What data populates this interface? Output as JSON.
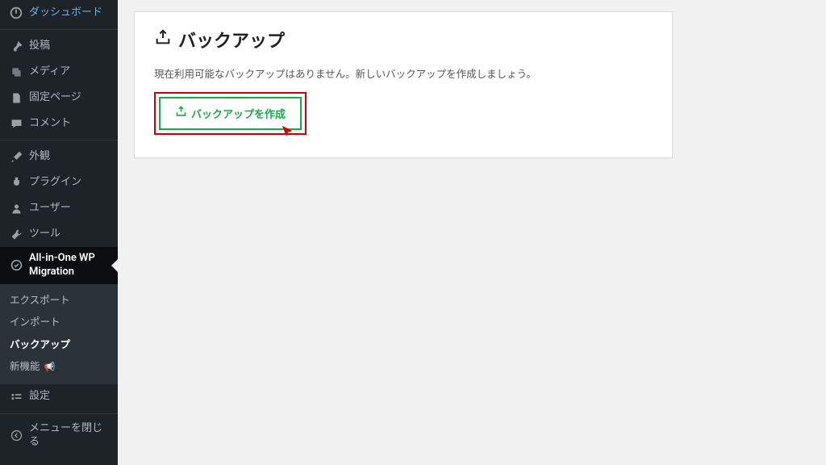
{
  "sidebar": {
    "items": [
      {
        "icon": "dashboard-icon",
        "label": "ダッシュボード"
      },
      {
        "icon": "pin-icon",
        "label": "投稿"
      },
      {
        "icon": "media-icon",
        "label": "メディア"
      },
      {
        "icon": "page-icon",
        "label": "固定ページ"
      },
      {
        "icon": "comment-icon",
        "label": "コメント"
      }
    ],
    "items2": [
      {
        "icon": "brush-icon",
        "label": "外観"
      },
      {
        "icon": "plugin-icon",
        "label": "プラグイン"
      },
      {
        "icon": "user-icon",
        "label": "ユーザー"
      },
      {
        "icon": "tool-icon",
        "label": "ツール"
      }
    ],
    "current": {
      "icon": "migration-icon",
      "label": "All-in-One WP Migration"
    },
    "submenu": [
      {
        "label": "エクスポート",
        "active": false
      },
      {
        "label": "インポート",
        "active": false
      },
      {
        "label": "バックアップ",
        "active": true
      },
      {
        "label": "新機能 ",
        "active": false,
        "announcer": "📢"
      }
    ],
    "items3": [
      {
        "icon": "settings-icon",
        "label": "設定"
      }
    ],
    "collapse": {
      "icon": "collapse-icon",
      "label": "メニューを閉じる"
    }
  },
  "panel": {
    "icon": "export-icon",
    "title": "バックアップ",
    "description": "現在利用可能なバックアップはありません。新しいバックアップを作成しましょう。",
    "create_btn_label": "バックアップを作成"
  }
}
